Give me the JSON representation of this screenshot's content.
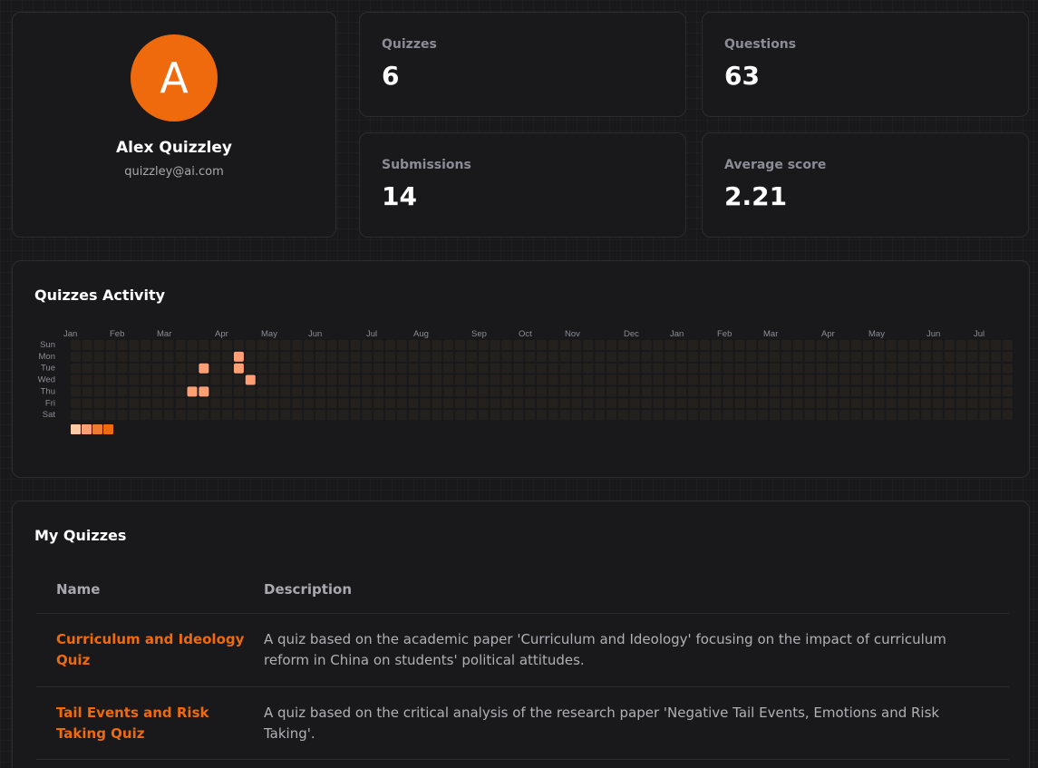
{
  "profile": {
    "initial": "A",
    "name": "Alex Quizzley",
    "email": "quizzley@ai.com",
    "avatar_color": "#ef6a0c"
  },
  "stats": {
    "quizzes": {
      "label": "Quizzes",
      "value": "6"
    },
    "questions": {
      "label": "Questions",
      "value": "63"
    },
    "submissions": {
      "label": "Submissions",
      "value": "14"
    },
    "average": {
      "label": "Average score",
      "value": "2.21"
    }
  },
  "activity": {
    "title": "Quizzes Activity",
    "months": [
      "Jan",
      "Feb",
      "Mar",
      "Apr",
      "May",
      "Jun",
      "Jul",
      "Aug",
      "Sep",
      "Oct",
      "Nov",
      "Dec",
      "Jan",
      "Feb",
      "Mar",
      "Apr",
      "May",
      "Jun",
      "Jul"
    ],
    "days": [
      "Sun",
      "Mon",
      "Tue",
      "Wed",
      "Thu",
      "Fri",
      "Sat"
    ],
    "colors": {
      "empty": "#23201d",
      "low": "#ffc9a6",
      "mid": "#ff9f73",
      "high": "#f07a30",
      "max": "#ef6a0c"
    },
    "cells": [
      {
        "week": 11,
        "day": 2,
        "level": "mid"
      },
      {
        "week": 11,
        "day": 4,
        "level": "mid"
      },
      {
        "week": 10,
        "day": 4,
        "level": "mid"
      },
      {
        "week": 14,
        "day": 1,
        "level": "mid"
      },
      {
        "week": 14,
        "day": 2,
        "level": "mid"
      },
      {
        "week": 15,
        "day": 3,
        "level": "mid"
      }
    ],
    "legend_levels": [
      "low",
      "mid",
      "high",
      "max"
    ]
  },
  "quizzes": {
    "title": "My Quizzes",
    "columns": {
      "name": "Name",
      "description": "Description"
    },
    "rows": [
      {
        "name": "Curriculum and Ideology Quiz",
        "description": "A quiz based on the academic paper 'Curriculum and Ideology' focusing on the impact of curriculum reform in China on students' political attitudes."
      },
      {
        "name": "Tail Events and Risk Taking Quiz",
        "description": "A quiz based on the critical analysis of the research paper 'Negative Tail Events, Emotions and Risk Taking'."
      }
    ]
  }
}
